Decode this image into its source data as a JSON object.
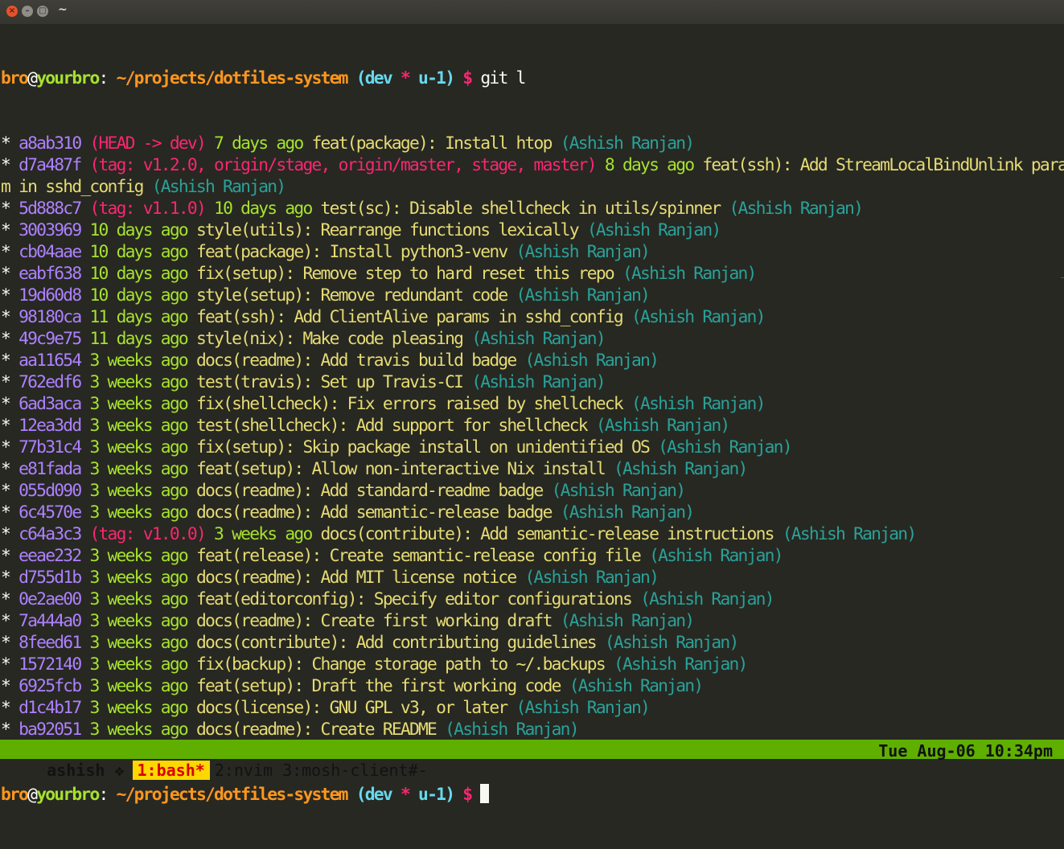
{
  "window": {
    "title": "~",
    "close_label": "×",
    "min_label": "–",
    "max_label": "□"
  },
  "prompt": {
    "user": "bro",
    "at": "@",
    "host": "yourbro",
    "colon": ":",
    "path": "~/projects/dotfiles-system",
    "paren_open": "(",
    "branch": "dev",
    "dirty": "*",
    "upstream": "u-1",
    "paren_close": ")",
    "dollar": "$",
    "command": "git l"
  },
  "commits": [
    {
      "star": "*",
      "hash": "a8ab310",
      "refs": "(HEAD -> dev)",
      "date": "7 days ago",
      "msg": "feat(package): Install htop",
      "author": "(Ashish Ranjan)"
    },
    {
      "star": "*",
      "hash": "d7a487f",
      "refs": "(tag: v1.2.0, origin/stage, origin/master, stage, master)",
      "date": "8 days ago",
      "msg": "feat(ssh): Add StreamLocalBindUnlink para",
      "author": ""
    },
    {
      "star": "",
      "hash": "",
      "refs": "",
      "date": "",
      "msg": "m in sshd_config",
      "author": "(Ashish Ranjan)"
    },
    {
      "star": "*",
      "hash": "5d888c7",
      "refs": "(tag: v1.1.0)",
      "date": "10 days ago",
      "msg": "test(sc): Disable shellcheck in utils/spinner",
      "author": "(Ashish Ranjan)"
    },
    {
      "star": "*",
      "hash": "3003969",
      "refs": "",
      "date": "10 days ago",
      "msg": "style(utils): Rearrange functions lexically",
      "author": "(Ashish Ranjan)"
    },
    {
      "star": "*",
      "hash": "cb04aae",
      "refs": "",
      "date": "10 days ago",
      "msg": "feat(package): Install python3-venv",
      "author": "(Ashish Ranjan)"
    },
    {
      "star": "*",
      "hash": "eabf638",
      "refs": "",
      "date": "10 days ago",
      "msg": "fix(setup): Remove step to hard reset this repo",
      "author": "(Ashish Ranjan)"
    },
    {
      "star": "*",
      "hash": "19d60d8",
      "refs": "",
      "date": "10 days ago",
      "msg": "style(setup): Remove redundant code",
      "author": "(Ashish Ranjan)"
    },
    {
      "star": "*",
      "hash": "98180ca",
      "refs": "",
      "date": "11 days ago",
      "msg": "feat(ssh): Add ClientAlive params in sshd_config",
      "author": "(Ashish Ranjan)"
    },
    {
      "star": "*",
      "hash": "49c9e75",
      "refs": "",
      "date": "11 days ago",
      "msg": "style(nix): Make code pleasing",
      "author": "(Ashish Ranjan)"
    },
    {
      "star": "*",
      "hash": "aa11654",
      "refs": "",
      "date": "3 weeks ago",
      "msg": "docs(readme): Add travis build badge",
      "author": "(Ashish Ranjan)"
    },
    {
      "star": "*",
      "hash": "762edf6",
      "refs": "",
      "date": "3 weeks ago",
      "msg": "test(travis): Set up Travis-CI",
      "author": "(Ashish Ranjan)"
    },
    {
      "star": "*",
      "hash": "6ad3aca",
      "refs": "",
      "date": "3 weeks ago",
      "msg": "fix(shellcheck): Fix errors raised by shellcheck",
      "author": "(Ashish Ranjan)"
    },
    {
      "star": "*",
      "hash": "12ea3dd",
      "refs": "",
      "date": "3 weeks ago",
      "msg": "test(shellcheck): Add support for shellcheck",
      "author": "(Ashish Ranjan)"
    },
    {
      "star": "*",
      "hash": "77b31c4",
      "refs": "",
      "date": "3 weeks ago",
      "msg": "fix(setup): Skip package install on unidentified OS",
      "author": "(Ashish Ranjan)"
    },
    {
      "star": "*",
      "hash": "e81fada",
      "refs": "",
      "date": "3 weeks ago",
      "msg": "feat(setup): Allow non-interactive Nix install",
      "author": "(Ashish Ranjan)"
    },
    {
      "star": "*",
      "hash": "055d090",
      "refs": "",
      "date": "3 weeks ago",
      "msg": "docs(readme): Add standard-readme badge",
      "author": "(Ashish Ranjan)"
    },
    {
      "star": "*",
      "hash": "6c4570e",
      "refs": "",
      "date": "3 weeks ago",
      "msg": "docs(readme): Add semantic-release badge",
      "author": "(Ashish Ranjan)"
    },
    {
      "star": "*",
      "hash": "c64a3c3",
      "refs": "(tag: v1.0.0)",
      "date": "3 weeks ago",
      "msg": "docs(contribute): Add semantic-release instructions",
      "author": "(Ashish Ranjan)"
    },
    {
      "star": "*",
      "hash": "eeae232",
      "refs": "",
      "date": "3 weeks ago",
      "msg": "feat(release): Create semantic-release config file",
      "author": "(Ashish Ranjan)"
    },
    {
      "star": "*",
      "hash": "d755d1b",
      "refs": "",
      "date": "3 weeks ago",
      "msg": "docs(readme): Add MIT license notice",
      "author": "(Ashish Ranjan)"
    },
    {
      "star": "*",
      "hash": "0e2ae00",
      "refs": "",
      "date": "3 weeks ago",
      "msg": "feat(editorconfig): Specify editor configurations",
      "author": "(Ashish Ranjan)"
    },
    {
      "star": "*",
      "hash": "7a444a0",
      "refs": "",
      "date": "3 weeks ago",
      "msg": "docs(readme): Create first working draft",
      "author": "(Ashish Ranjan)"
    },
    {
      "star": "*",
      "hash": "8feed61",
      "refs": "",
      "date": "3 weeks ago",
      "msg": "docs(contribute): Add contributing guidelines",
      "author": "(Ashish Ranjan)"
    },
    {
      "star": "*",
      "hash": "1572140",
      "refs": "",
      "date": "3 weeks ago",
      "msg": "fix(backup): Change storage path to ~/.backups",
      "author": "(Ashish Ranjan)"
    },
    {
      "star": "*",
      "hash": "6925fcb",
      "refs": "",
      "date": "3 weeks ago",
      "msg": "feat(setup): Draft the first working code",
      "author": "(Ashish Ranjan)"
    },
    {
      "star": "*",
      "hash": "d1c4b17",
      "refs": "",
      "date": "3 weeks ago",
      "msg": "docs(license): GNU GPL v3, or later",
      "author": "(Ashish Ranjan)"
    },
    {
      "star": "*",
      "hash": "ba92051",
      "refs": "",
      "date": "3 weeks ago",
      "msg": "docs(readme): Create README",
      "author": "(Ashish Ranjan)"
    }
  ],
  "statusbar": {
    "session": "ashish",
    "separator": "❖",
    "windows": [
      {
        "label": "1:bash*",
        "active": true
      },
      {
        "label": "2:nvim",
        "active": false
      },
      {
        "label": "3:mosh-client#-",
        "active": false
      }
    ],
    "datetime": "Tue Aug-06 10:34pm"
  },
  "colors": {
    "background": "#272822",
    "hash": "#ae81ff",
    "refs": "#f92672",
    "date": "#a6e22e",
    "message": "#e6db74",
    "author": "#2aa198",
    "status_bar": "#5faf00",
    "active_window": "#ffd700"
  }
}
